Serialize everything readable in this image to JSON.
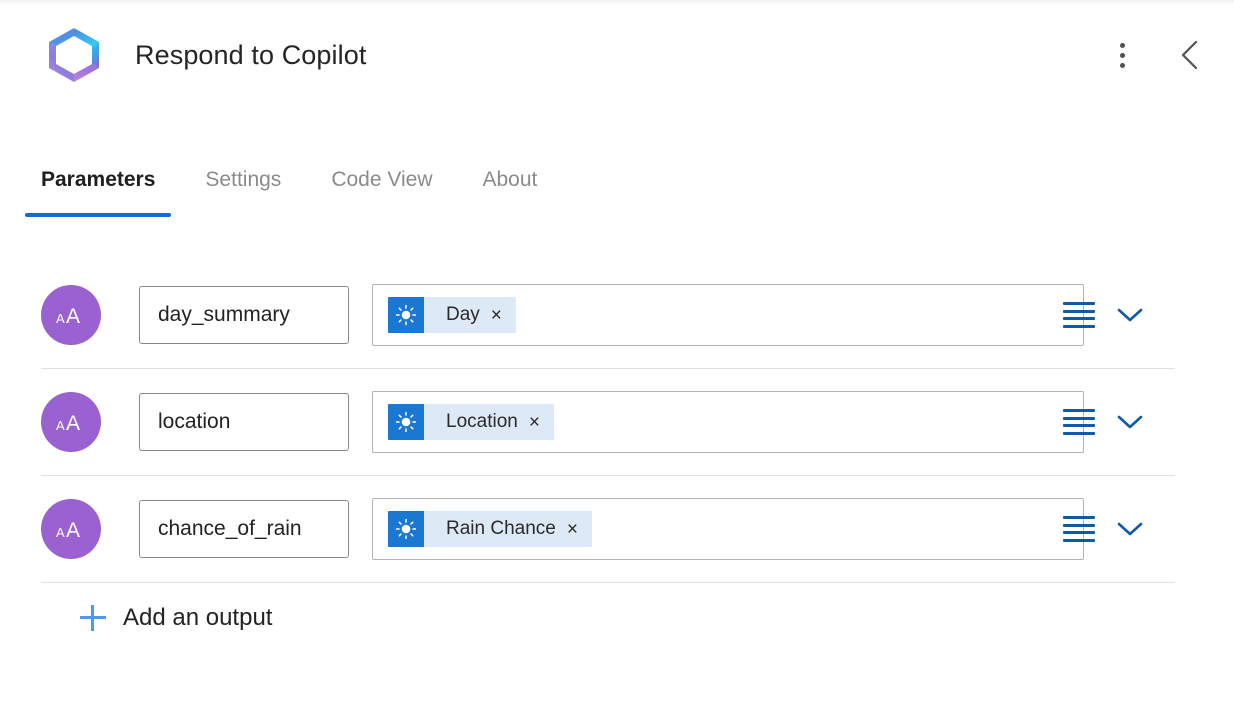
{
  "header": {
    "logo_icon": "copilot-logo",
    "title": "Respond to Copilot",
    "more_icon": "more-vertical-icon",
    "back_icon": "chevron-left-icon",
    "colors": {
      "logo_cyan": "#36C5F0",
      "logo_blue": "#2F7FE0",
      "logo_purple": "#9B6BDF",
      "logo_magenta": "#B07CE0"
    }
  },
  "tabs": {
    "active": "Parameters",
    "accent": "#1768e0",
    "items": [
      {
        "label": "Parameters"
      },
      {
        "label": "Settings"
      },
      {
        "label": "Code View"
      },
      {
        "label": "About"
      }
    ]
  },
  "parameters": {
    "rows": [
      {
        "type_icon": "text-type-icon",
        "name": "day_summary",
        "token": {
          "icon": "weather-sun-icon",
          "label": "Day",
          "remove": "×"
        },
        "dynamic_content_icon": "dynamic-content-icon",
        "expand_icon": "chevron-down-icon"
      },
      {
        "type_icon": "text-type-icon",
        "name": "location",
        "token": {
          "icon": "weather-sun-icon",
          "label": "Location",
          "remove": "×"
        },
        "dynamic_content_icon": "dynamic-content-icon",
        "expand_icon": "chevron-down-icon"
      },
      {
        "type_icon": "text-type-icon",
        "name": "chance_of_rain",
        "token": {
          "icon": "weather-sun-icon",
          "label": "Rain Chance",
          "remove": "×"
        },
        "dynamic_content_icon": "dynamic-content-icon",
        "expand_icon": "chevron-down-icon"
      }
    ],
    "add_output": {
      "icon": "plus-icon",
      "label": "Add an output"
    }
  },
  "colors": {
    "token_icon_bg": "#1a77d2",
    "token_bg": "#dee9f7",
    "avatar_bg": "#9a62d0",
    "row_action_blue": "#0f5aa8",
    "plus_blue": "#4a9bef"
  }
}
